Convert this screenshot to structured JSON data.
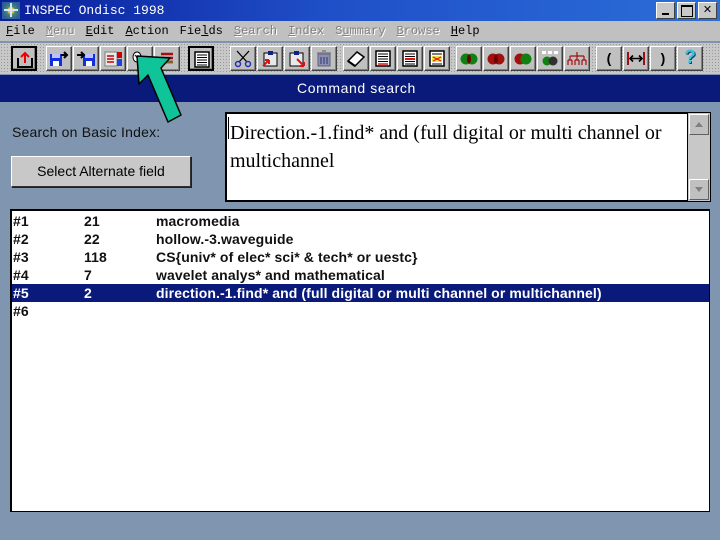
{
  "window": {
    "title": "INSPEC Ondisc 1998",
    "controls": [
      "minimize",
      "maximize",
      "close"
    ],
    "close_glyph": "✕"
  },
  "menu": [
    {
      "label": "File",
      "accel": "F",
      "enabled": true
    },
    {
      "label": "Menu",
      "accel": "M",
      "enabled": false
    },
    {
      "label": "Edit",
      "accel": "E",
      "enabled": true
    },
    {
      "label": "Action",
      "accel": "A",
      "enabled": true
    },
    {
      "label": "Fields",
      "accel": "l",
      "enabled": true
    },
    {
      "label": "Search",
      "accel": "S",
      "enabled": false
    },
    {
      "label": "Index",
      "accel": "I",
      "enabled": false
    },
    {
      "label": "Summary",
      "accel": "u",
      "enabled": false
    },
    {
      "label": "Browse",
      "accel": "B",
      "enabled": false
    },
    {
      "label": "Help",
      "accel": "H",
      "enabled": true
    }
  ],
  "toolbar": [
    {
      "name": "exit-icon"
    },
    {
      "name": "save-search-icon"
    },
    {
      "name": "load-search-icon"
    },
    {
      "name": "records-icon"
    },
    {
      "name": "lookup-icon"
    },
    {
      "name": "list-icon"
    },
    {
      "name": "full-record-icon"
    },
    {
      "name": "cut-icon"
    },
    {
      "name": "copy-icon"
    },
    {
      "name": "paste-icon"
    },
    {
      "name": "trash-icon"
    },
    {
      "name": "eraser-icon"
    },
    {
      "name": "document-lines-icon"
    },
    {
      "name": "document-marked-icon"
    },
    {
      "name": "document-highlight-icon"
    },
    {
      "name": "operator-and-icon"
    },
    {
      "name": "operator-or-icon"
    },
    {
      "name": "operator-not-icon"
    },
    {
      "name": "operator-xor-icon"
    },
    {
      "name": "thesaurus-tree-icon"
    },
    {
      "name": "open-paren-icon",
      "glyph": "("
    },
    {
      "name": "proximity-icon",
      "glyph": "↔"
    },
    {
      "name": "close-paren-icon",
      "glyph": ")"
    },
    {
      "name": "help-icon",
      "glyph": "?"
    }
  ],
  "panel": {
    "header": "Command search",
    "search_label": "Search on Basic Index:",
    "alt_field_button": "Select Alternate field",
    "query_value": "Direction.-1.find* and (full digital or multi channel or multichannel"
  },
  "history": {
    "selected_index": 4,
    "rows": [
      {
        "num": "#1",
        "hits": "21",
        "query": "macromedia"
      },
      {
        "num": "#2",
        "hits": "22",
        "query": "hollow.-3.waveguide"
      },
      {
        "num": "#3",
        "hits": "118",
        "query": "CS{univ* of elec* sci* & tech* or uestc}"
      },
      {
        "num": "#4",
        "hits": "7",
        "query": "wavelet analys* and mathematical"
      },
      {
        "num": "#5",
        "hits": "2",
        "query": "direction.-1.find* and (full digital or multi channel or multichannel)"
      },
      {
        "num": "#6",
        "hits": "",
        "query": ""
      }
    ]
  },
  "colors": {
    "header_bg": "#0a1a7a",
    "selection_bg": "#0a1a7a",
    "panel_bg": "#8096b0",
    "arrow": "#10c49a"
  }
}
